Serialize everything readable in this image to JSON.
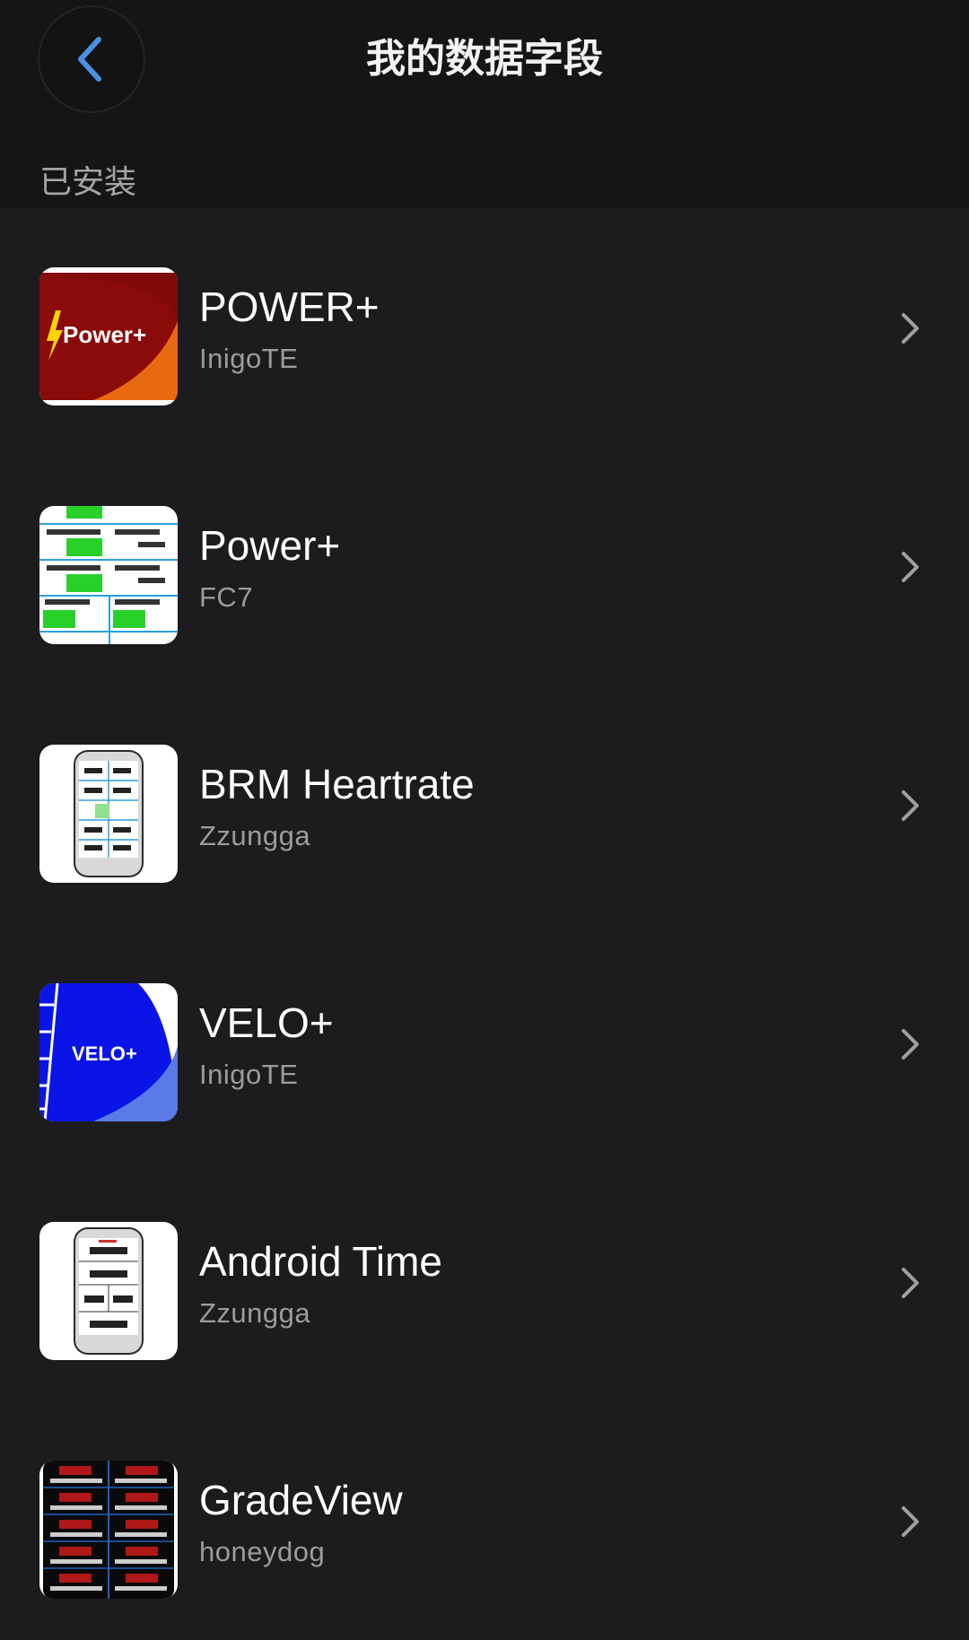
{
  "header": {
    "title": "我的数据字段",
    "back_icon": "chevron-left-icon",
    "accent_color": "#4a90e2"
  },
  "section": {
    "label": "已安装"
  },
  "items": [
    {
      "name": "POWER+",
      "author": "InigoTE",
      "icon": "power-plus-app-icon"
    },
    {
      "name": "Power+",
      "author": "FC7",
      "icon": "power-plus-screens-app-icon"
    },
    {
      "name": "BRM Heartrate",
      "author": "Zzungga",
      "icon": "garmin-device-heartrate-app-icon"
    },
    {
      "name": "VELO+",
      "author": "InigoTE",
      "icon": "velo-plus-app-icon"
    },
    {
      "name": "Android Time",
      "author": "Zzungga",
      "icon": "garmin-device-time-app-icon"
    },
    {
      "name": "GradeView",
      "author": "honeydog",
      "icon": "gradeview-app-icon"
    }
  ],
  "icon_text": {
    "power_plus": "Power+",
    "velo_plus": "VELO+"
  }
}
